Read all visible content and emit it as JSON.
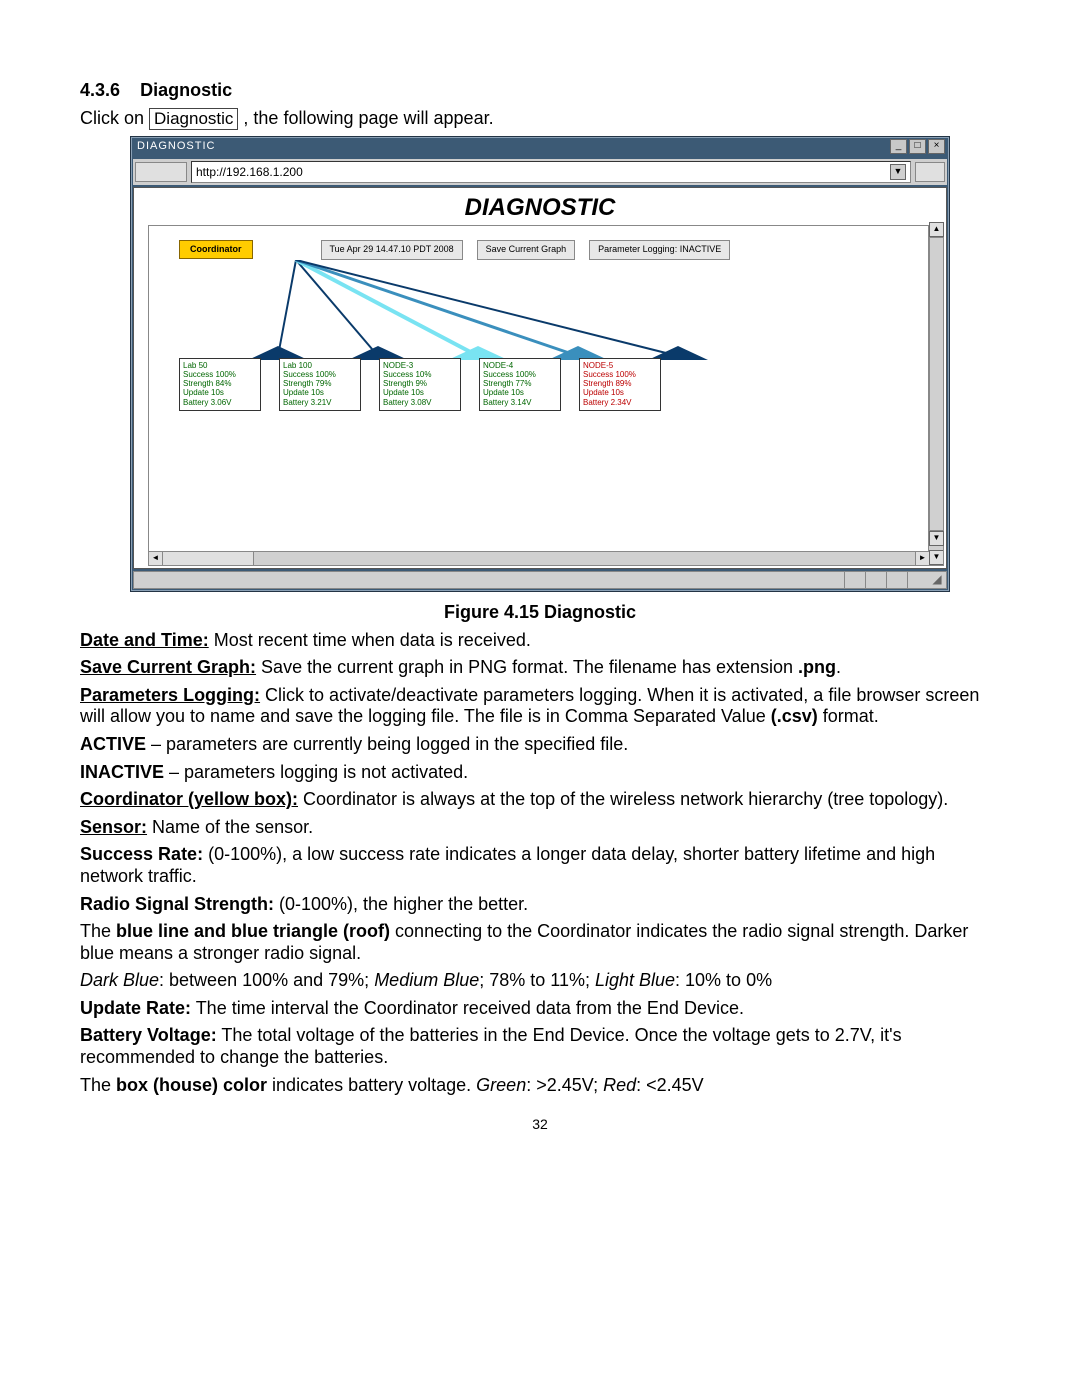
{
  "section": {
    "num": "4.3.6",
    "title": "Diagnostic"
  },
  "intro": {
    "pre": "Click on ",
    "btn": "Diagnostic",
    "post": ", the following page will appear."
  },
  "window": {
    "title": "DIAGNOSTIC",
    "url": "http://192.168.1.200",
    "heading": "DIAGNOSTIC",
    "coordinator_label": "Coordinator",
    "timestamp_btn": "Tue Apr 29 14.47.10 PDT 2008",
    "save_btn": "Save Current Graph",
    "logging_btn": "Parameter Logging: INACTIVE",
    "nodes": [
      {
        "name": "Lab 50",
        "success": "Success 100%",
        "strength": "Strength 84%",
        "update": "Update 10s",
        "battery": "Battery 3.06V",
        "cls": "green",
        "roof": "#0a3a6a"
      },
      {
        "name": "Lab 100",
        "success": "Success 100%",
        "strength": "Strength 79%",
        "update": "Update 10s",
        "battery": "Battery 3.21V",
        "cls": "green",
        "roof": "#0a3a6a"
      },
      {
        "name": "NODE-3",
        "success": "Success 10%",
        "strength": "Strength 9%",
        "update": "Update 10s",
        "battery": "Battery 3.08V",
        "cls": "green",
        "roof": "#79e3f2"
      },
      {
        "name": "NODE-4",
        "success": "Success 100%",
        "strength": "Strength 77%",
        "update": "Update 10s",
        "battery": "Battery 3.14V",
        "cls": "green",
        "roof": "#3a8fbd"
      },
      {
        "name": "NODE-5",
        "success": "Success 100%",
        "strength": "Strength 89%",
        "update": "Update 10s",
        "battery": "Battery 2.34V",
        "cls": "red",
        "roof": "#0a3a6a"
      }
    ]
  },
  "caption": "Figure 4.15  Diagnostic",
  "defs": {
    "date_time_l": "Date and Time:",
    "date_time": "  Most recent time when data is received.",
    "save_l": "Save Current Graph:",
    "save1": "  Save the current graph in PNG format. The filename has extension ",
    "save_ext": ".png",
    "save2": ".",
    "plog_l": "Parameters Logging:",
    "plog": "  Click to activate/deactivate parameters logging. When it is activated, a file browser screen will allow you to name and save the logging file.  The file is in Comma Separated Value ",
    "plog_fmt": "(.csv)",
    "plog2": " format.",
    "active_l": "ACTIVE",
    "active": " – parameters are currently being logged in the specified file.",
    "inactive_l": "INACTIVE",
    "inactive": " – parameters logging is not activated.",
    "coord_l": "Coordinator (yellow box):",
    "coord": "  Coordinator is always at the top of the wireless network hierarchy (tree topology).",
    "sensor_l": "Sensor:",
    "sensor": "  Name of the sensor.",
    "succ_l": "Success Rate:",
    "succ": " (0-100%), a low success rate indicates a longer data delay, shorter battery lifetime and high network traffic.",
    "rss_l": "Radio Signal Strength:",
    "rss": " (0-100%), the higher the better.",
    "line1_a": "The ",
    "line1_b": "blue line and blue triangle (roof)",
    "line1_c": " connecting to the Coordinator indicates the radio signal strength. Darker blue means a stronger radio signal.",
    "scale_db": "Dark Blue",
    "scale_db_v": ": between 100% and 79%; ",
    "scale_mb": "Medium Blue",
    "scale_mb_v": "; 78% to 11%; ",
    "scale_lb": "Light Blue",
    "scale_lb_v": ": 10% to 0%",
    "upd_l": "Update Rate:",
    "upd": "  The time interval the Coordinator received data from the End Device.",
    "batt_l": "Battery Voltage:",
    "batt": "  The total voltage of the batteries in the End Device.  Once the voltage gets to 2.7V, it's recommended to change the batteries.",
    "box1": "The ",
    "box2": "box (house) color",
    "box3": " indicates battery voltage.  ",
    "box_g": "Green",
    "box_g_v": ": >2.45V;  ",
    "box_r": "Red",
    "box_r_v": ": <2.45V"
  },
  "page_number": "32"
}
